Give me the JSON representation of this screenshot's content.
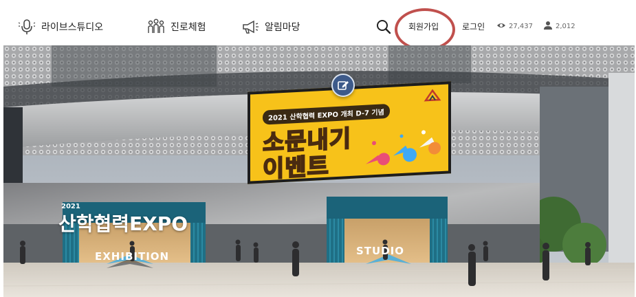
{
  "nav": {
    "items": [
      {
        "label": "라이브스튜디오",
        "icon": "microphone-icon"
      },
      {
        "label": "진로체험",
        "icon": "people-icon"
      },
      {
        "label": "알림마당",
        "icon": "megaphone-icon"
      }
    ]
  },
  "header": {
    "search_icon": "search-icon",
    "join_label": "회원가입",
    "login_label": "로그인",
    "views_count": "27,437",
    "members_count": "2,012",
    "highlight_color": "#c0504d"
  },
  "scene": {
    "billboard": {
      "tag": "2021 산학협력 EXPO 개최 D-7 기념",
      "line1": "소문내기",
      "line2": "이벤트"
    },
    "expo_year": "2021",
    "expo_title": "산학협력EXPO",
    "exhibition_label": "EXHIBITION",
    "studio_label": "STUDIO",
    "edit_icon": "edit-icon"
  }
}
